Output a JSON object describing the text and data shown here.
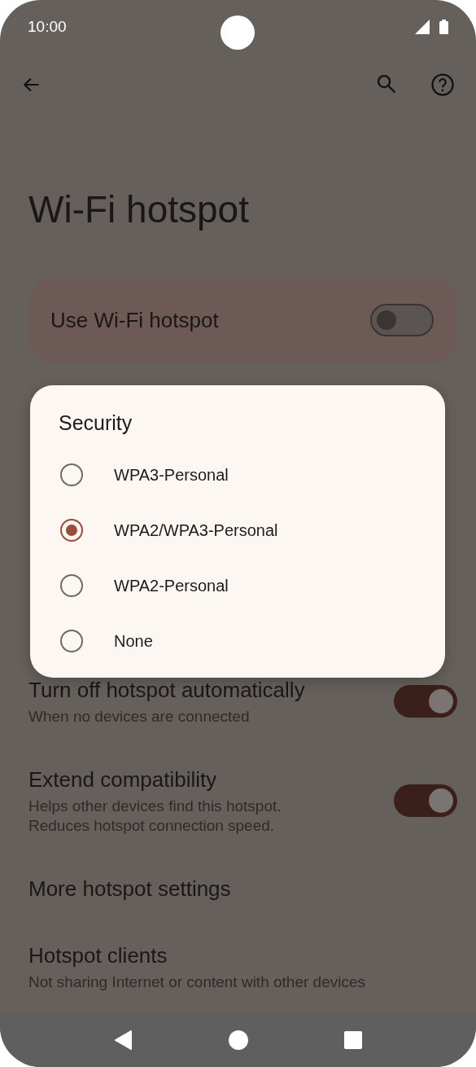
{
  "status_bar": {
    "time": "10:00"
  },
  "title": "Wi-Fi hotspot",
  "main_toggle": {
    "label": "Use Wi-Fi hotspot",
    "on": false
  },
  "settings": [
    {
      "kind": "switch",
      "title": "Turn off hotspot automatically",
      "summary": "When no devices are connected",
      "on": true
    },
    {
      "kind": "switch",
      "title": "Extend compatibility",
      "summary": "Helps other devices find this hotspot.\nReduces hotspot connection speed.",
      "on": true
    },
    {
      "kind": "link",
      "title": "More hotspot settings"
    },
    {
      "kind": "link",
      "title": "Hotspot clients",
      "summary": "Not sharing Internet or content with other devices"
    }
  ],
  "dialog": {
    "title": "Security",
    "options": [
      {
        "label": "WPA3-Personal",
        "selected": false
      },
      {
        "label": "WPA2/WPA3-Personal",
        "selected": true
      },
      {
        "label": "WPA2-Personal",
        "selected": false
      },
      {
        "label": "None",
        "selected": false
      }
    ]
  }
}
